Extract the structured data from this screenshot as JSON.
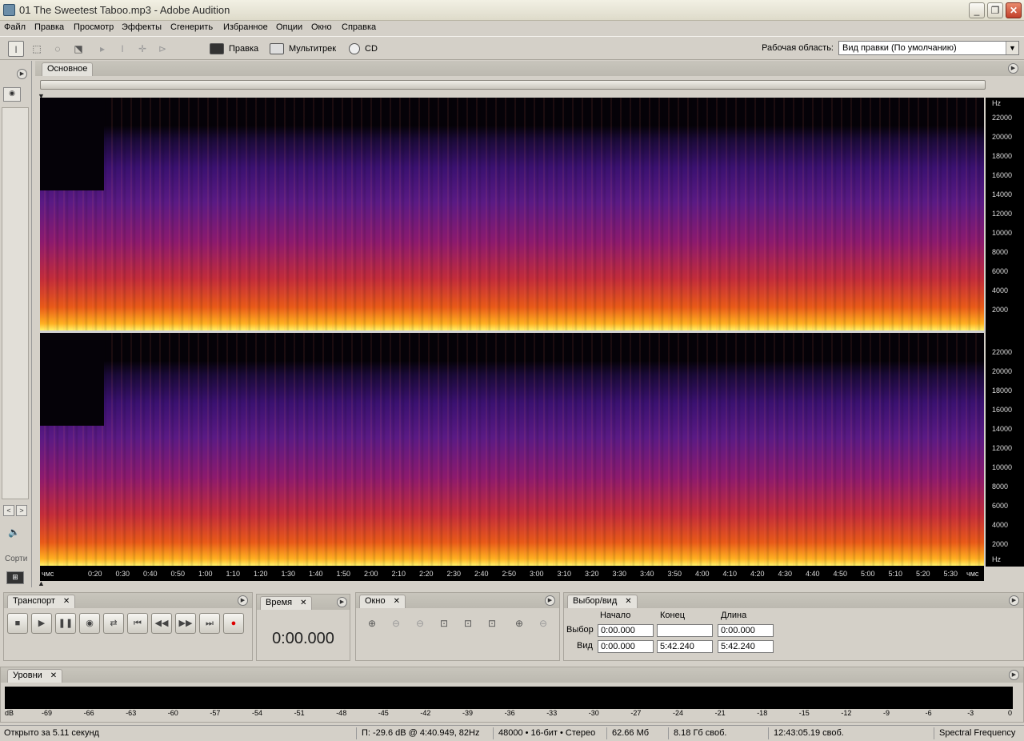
{
  "title": "01  The Sweetest Taboo.mp3 - Adobe Audition",
  "menu": [
    "Файл",
    "Правка",
    "Просмотр",
    "Эффекты",
    "Сгенерить",
    "Избранное",
    "Опции",
    "Окно",
    "Справка"
  ],
  "toolbar": {
    "edit_label": "Правка",
    "multitrack_label": "Мультитрек",
    "cd_label": "CD",
    "workspace_label": "Рабочая область:",
    "workspace_value": "Вид правки (По умолчанию)"
  },
  "main_tab": "Основное",
  "hz_unit": "Hz",
  "hz_ticks": [
    "22000",
    "20000",
    "18000",
    "16000",
    "14000",
    "12000",
    "10000",
    "8000",
    "6000",
    "4000",
    "2000"
  ],
  "hz_ticks_bottom": [
    "22000",
    "20000",
    "18000",
    "16000",
    "14000",
    "12000",
    "10000",
    "8000",
    "6000",
    "4000",
    "2000"
  ],
  "time_ticks": [
    "чмс",
    "0:20",
    "0:30",
    "0:40",
    "0:50",
    "1:00",
    "1:10",
    "1:20",
    "1:30",
    "1:40",
    "1:50",
    "2:00",
    "2:10",
    "2:20",
    "2:30",
    "2:40",
    "2:50",
    "3:00",
    "3:10",
    "3:20",
    "3:30",
    "3:40",
    "3:50",
    "4:00",
    "4:10",
    "4:20",
    "4:30",
    "4:40",
    "4:50",
    "5:00",
    "5:10",
    "5:20",
    "5:30",
    "чмс"
  ],
  "left_panel": {
    "sort_label": "Сорти"
  },
  "transport": {
    "tab": "Транспорт"
  },
  "time": {
    "tab": "Время",
    "value": "0:00.000"
  },
  "zoom": {
    "tab": "Окно"
  },
  "selection": {
    "tab": "Выбор/вид",
    "col_start": "Начало",
    "col_end": "Конец",
    "col_length": "Длина",
    "row_selection": "Выбор",
    "row_view": "Вид",
    "sel_start": "0:00.000",
    "sel_end": "",
    "sel_length": "0:00.000",
    "view_start": "0:00.000",
    "view_end": "5:42.240",
    "view_length": "5:42.240"
  },
  "levels": {
    "tab": "Уровни",
    "scale": [
      "dB",
      "-69",
      "-66",
      "-63",
      "-60",
      "-57",
      "-54",
      "-51",
      "-48",
      "-45",
      "-42",
      "-39",
      "-36",
      "-33",
      "-30",
      "-27",
      "-24",
      "-21",
      "-18",
      "-15",
      "-12",
      "-9",
      "-6",
      "-3",
      "0"
    ]
  },
  "status": {
    "opened": "Открыто за 5.11 секунд",
    "cursor": "П: -29.6 dB @   4:40.949, 82Hz",
    "format": "48000 • 16-бит • Стерео",
    "size": "62.66 Мб",
    "free": "8.18 Гб своб.",
    "free_time": "12:43:05.19 своб.",
    "view_mode": "Spectral Frequency"
  }
}
